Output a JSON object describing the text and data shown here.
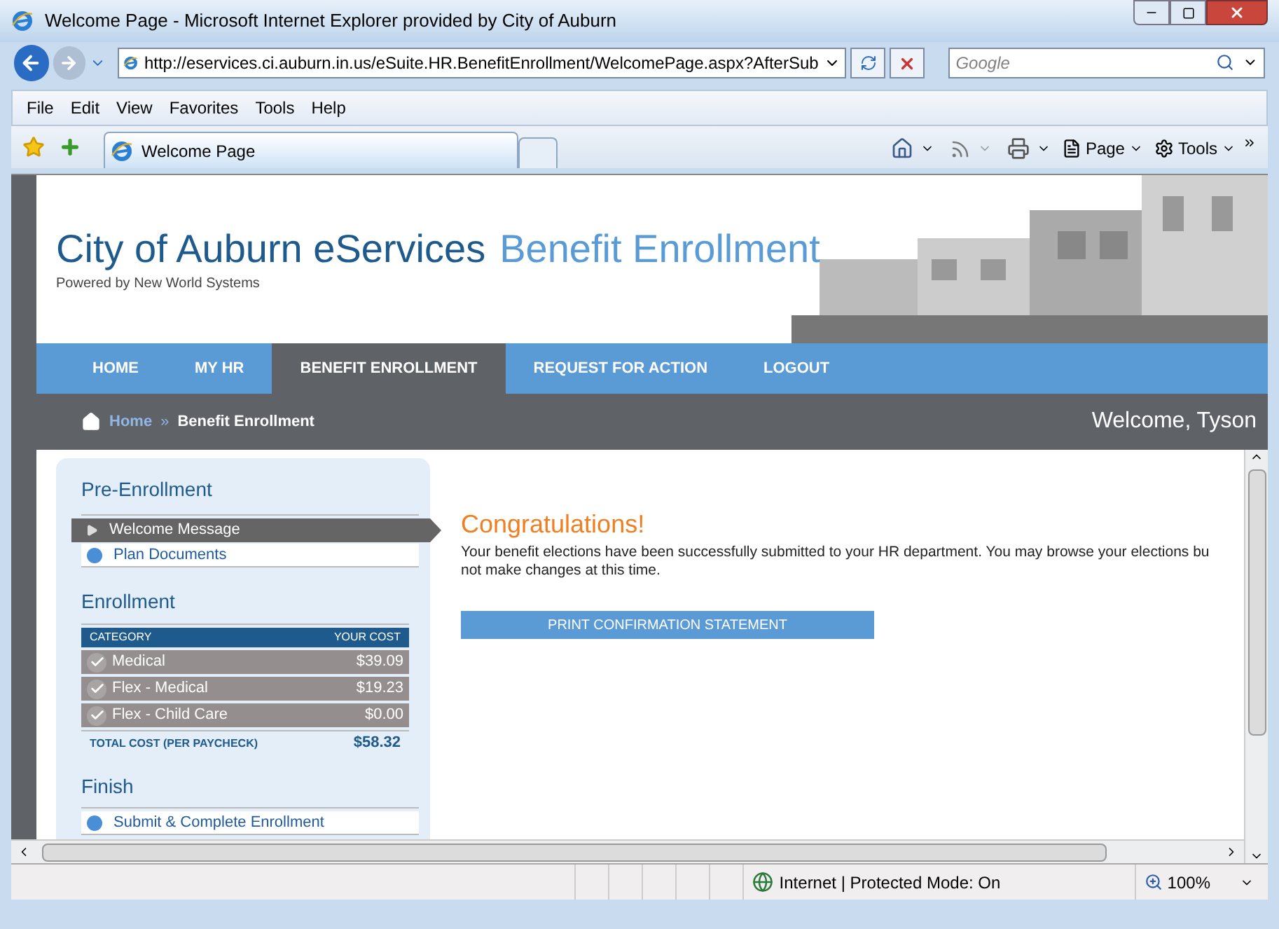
{
  "window": {
    "title": "Welcome Page - Microsoft Internet Explorer provided by City of Auburn"
  },
  "address_bar": {
    "url": "http://eservices.ci.auburn.in.us/eSuite.HR.BenefitEnrollment/WelcomePage.aspx?AfterSub"
  },
  "search": {
    "placeholder": "Google"
  },
  "menu": [
    "File",
    "Edit",
    "View",
    "Favorites",
    "Tools",
    "Help"
  ],
  "tab": {
    "label": "Welcome Page"
  },
  "command_bar": [
    "Page",
    "Tools"
  ],
  "site": {
    "title": "City of Auburn eServices",
    "subtitle": "Benefit Enrollment",
    "powered_by": "Powered by New World Systems"
  },
  "nav": [
    {
      "label": "HOME",
      "selected": false
    },
    {
      "label": "MY HR",
      "selected": false
    },
    {
      "label": "BENEFIT ENROLLMENT",
      "selected": true
    },
    {
      "label": "REQUEST FOR ACTION",
      "selected": false
    },
    {
      "label": "LOGOUT",
      "selected": false
    }
  ],
  "breadcrumb": {
    "home": "Home",
    "separator": "»",
    "current": "Benefit Enrollment"
  },
  "welcome": "Welcome, Tyson",
  "pre_enrollment": {
    "heading": "Pre-Enrollment",
    "items": [
      {
        "label": "Welcome Message",
        "selected": true
      },
      {
        "label": "Plan Documents",
        "selected": false
      }
    ]
  },
  "enrollment": {
    "heading": "Enrollment",
    "columns": [
      "CATEGORY",
      "YOUR COST"
    ],
    "rows": [
      {
        "category": "Medical",
        "cost": "$39.09",
        "checked": true
      },
      {
        "category": "Flex - Medical",
        "cost": "$19.23",
        "checked": true
      },
      {
        "category": "Flex - Child Care",
        "cost": "$0.00",
        "checked": true
      }
    ],
    "total_label": "TOTAL COST (PER PAYCHECK)",
    "total": "$58.32"
  },
  "finish": {
    "heading": "Finish",
    "items": [
      {
        "label": "Submit & Complete Enrollment",
        "selected": false
      }
    ]
  },
  "main": {
    "heading": "Congratulations!",
    "message_lines": [
      "Your benefit elections have been successfully submitted to your HR department. You may browse your elections bu",
      "not make changes at this time."
    ],
    "button": "PRINT CONFIRMATION STATEMENT"
  },
  "status_bar": {
    "zone": "Internet | Protected Mode: On",
    "zoom": "100%"
  }
}
